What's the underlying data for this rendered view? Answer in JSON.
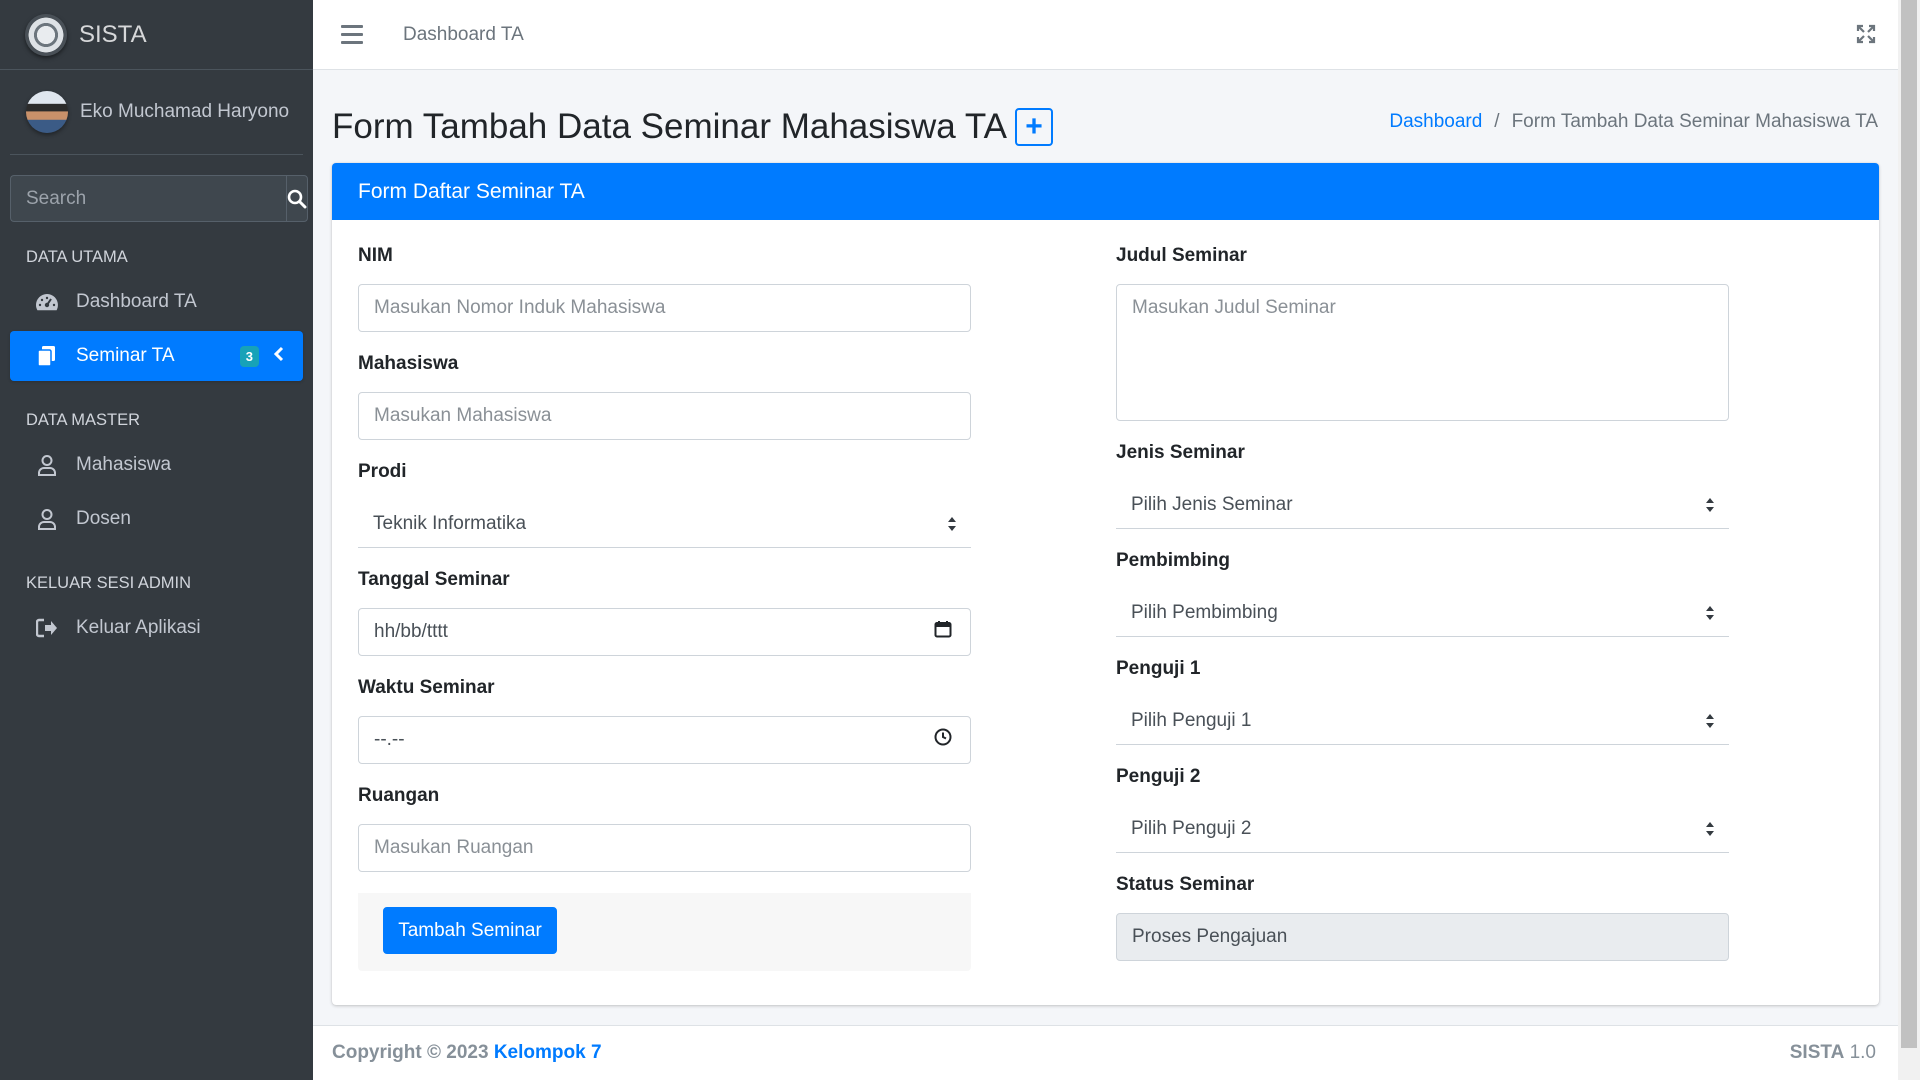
{
  "brand": {
    "name": "SISTA"
  },
  "user": {
    "name": "Eko Muchamad Haryono"
  },
  "sidebar": {
    "search_placeholder": "Search",
    "sections": [
      {
        "header": "DATA UTAMA"
      },
      {
        "header": "DATA MASTER"
      },
      {
        "header": "KELUAR SESI ADMIN"
      }
    ],
    "items": [
      {
        "label": "Dashboard TA",
        "icon": "tachometer-icon"
      },
      {
        "label": "Seminar TA",
        "icon": "copy-icon",
        "badge": "3",
        "active": true
      },
      {
        "label": "Mahasiswa",
        "icon": "user-icon"
      },
      {
        "label": "Dosen",
        "icon": "user-icon"
      },
      {
        "label": "Keluar Aplikasi",
        "icon": "sign-out-icon"
      }
    ]
  },
  "navbar": {
    "link": "Dashboard TA"
  },
  "page": {
    "title": "Form Tambah Data Seminar Mahasiswa TA",
    "add_button": "+",
    "breadcrumb": {
      "home": "Dashboard",
      "separator": "/",
      "current": "Form Tambah Data Seminar Mahasiswa TA"
    }
  },
  "form": {
    "header": "Form Daftar Seminar TA",
    "nim": {
      "label": "NIM",
      "placeholder": "Masukan Nomor Induk Mahasiswa"
    },
    "mahasiswa": {
      "label": "Mahasiswa",
      "placeholder": "Masukan Mahasiswa"
    },
    "prodi": {
      "label": "Prodi",
      "value": "Teknik Informatika"
    },
    "tanggal": {
      "label": "Tanggal Seminar",
      "value": "hh/bb/tttt"
    },
    "waktu": {
      "label": "Waktu Seminar",
      "value": "--.--"
    },
    "ruangan": {
      "label": "Ruangan",
      "placeholder": "Masukan Ruangan"
    },
    "judul": {
      "label": "Judul Seminar",
      "placeholder": "Masukan Judul Seminar"
    },
    "jenis": {
      "label": "Jenis Seminar",
      "value": "Pilih Jenis Seminar"
    },
    "pembimbing": {
      "label": "Pembimbing",
      "value": "Pilih Pembimbing"
    },
    "penguji1": {
      "label": "Penguji 1",
      "value": "Pilih Penguji 1"
    },
    "penguji2": {
      "label": "Penguji 2",
      "value": "Pilih Penguji 2"
    },
    "status": {
      "label": "Status Seminar",
      "value": "Proses Pengajuan"
    },
    "submit_label": "Tambah Seminar"
  },
  "footer": {
    "copyright": "Copyright © 2023",
    "team": "Kelompok 7",
    "app": "SISTA",
    "version": "1.0"
  },
  "colors": {
    "primary": "#007bff",
    "sidebar_bg": "#343a40",
    "badge": "#17a2b8"
  }
}
